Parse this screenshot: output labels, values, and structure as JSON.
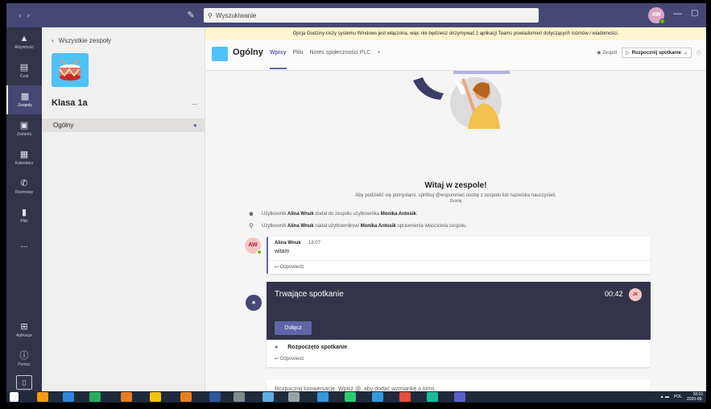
{
  "titlebar": {
    "search_placeholder": "Wyszukiwanie",
    "user_initials": "AW"
  },
  "appbar": {
    "items": [
      {
        "label": "Aktywność",
        "icon": "bell-icon"
      },
      {
        "label": "Czat",
        "icon": "chat-icon"
      },
      {
        "label": "Zespoły",
        "icon": "teams-icon"
      },
      {
        "label": "Zadania",
        "icon": "assignments-icon"
      },
      {
        "label": "Kalendarz",
        "icon": "calendar-icon"
      },
      {
        "label": "Rozmowy",
        "icon": "phone-icon"
      },
      {
        "label": "Pliki",
        "icon": "files-icon"
      }
    ],
    "more": "...",
    "apps_label": "Aplikacje",
    "help_label": "Pomoc"
  },
  "teams_panel": {
    "back_label": "Wszystkie zespoły",
    "team_name": "Klasa 1a",
    "more": "...",
    "channel": "Ogólny"
  },
  "main": {
    "banner": "Opcja Godziny ciszy systemu Windows jest włączona, więc nie będziesz otrzymywać z aplikacji Teams powiadomień dotyczących rozmów i wiadomości.",
    "channel_title": "Ogólny",
    "tabs": [
      "Wpisy",
      "Pliki",
      "Notes społeczności PLC"
    ],
    "add_tab": "+",
    "team_button": "Zespół",
    "meet_button": "Rozpocznij spotkanie",
    "welcome_title": "Witaj w zespole!",
    "welcome_sub": "Aby podzielić się pomysłami, spróbuj @wspomnieć osobę z zespołu lub nazwiska nauczycieli.",
    "date_separator": "Dzisiaj",
    "system_messages": [
      {
        "pre": "Użytkownik ",
        "user": "Alina Wnuk",
        "mid": " dodał do zespołu użytkownika ",
        "target": "Monika Antosik",
        "post": "."
      },
      {
        "pre": "Użytkownik ",
        "user": "Alina Wnuk",
        "mid": " nadał użytkownikowi ",
        "target": "Monika Antosik",
        "post": " uprawnienia właściciela zespołu."
      }
    ],
    "post": {
      "avatar": "AW",
      "author": "Alina Wnuk",
      "time": "18:07",
      "text": "witam",
      "reply": "Odpowiedz"
    },
    "meeting": {
      "title": "Trwające spotkanie",
      "timer": "00:42",
      "participant": "JK",
      "join": "Dołącz",
      "started": "Rozpoczęto spotkanie",
      "reply": "Odpowiedz"
    },
    "composer": {
      "placeholder": "Rozpocznij konwersację. Wpisz @, aby dodać wzmiankę o kimś."
    }
  },
  "taskbar": {
    "lang": "POL",
    "time": "18:10",
    "date": "2020-08-"
  },
  "colors": {
    "brand": "#464775",
    "accent": "#6264a7",
    "appbar": "#33344a",
    "meeting_bg": "#33344a"
  }
}
